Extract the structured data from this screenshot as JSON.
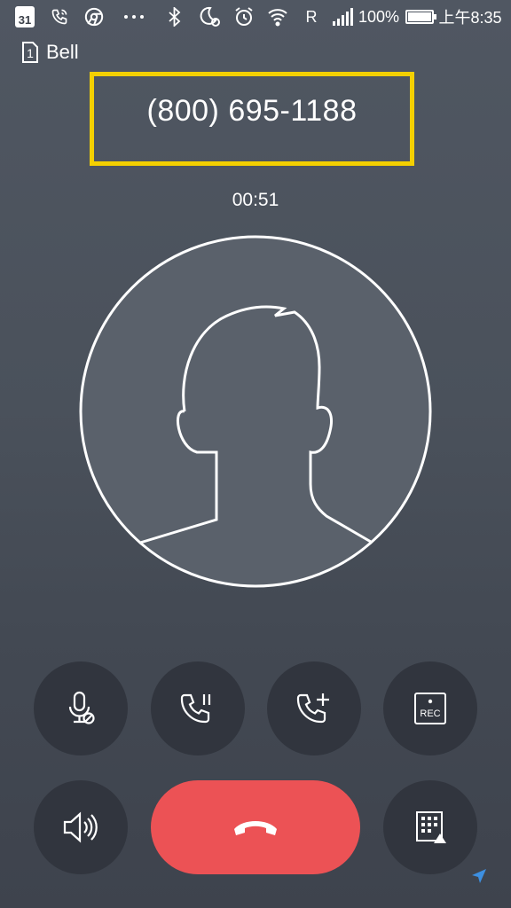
{
  "status_bar": {
    "calendar_day": "31",
    "carrier_indicator": "R",
    "battery_percent": "100%",
    "battery_level": 1.0,
    "time": "上午8:35",
    "icons": [
      "calendar-icon",
      "phone-call-icon",
      "chrome-icon",
      "more-icon",
      "bluetooth-icon",
      "do-not-disturb-moon-icon",
      "alarm-icon",
      "wifi-icon",
      "signal-icon",
      "battery-icon"
    ]
  },
  "call": {
    "sim_slot": "1",
    "carrier": "Bell",
    "phone_number": "(800) 695-1188",
    "duration": "00:51",
    "highlight_color": "#f4d000"
  },
  "actions": [
    {
      "name": "mute-button",
      "icon": "mic-mute-icon"
    },
    {
      "name": "hold-button",
      "icon": "phone-pause-icon"
    },
    {
      "name": "add-call-button",
      "icon": "phone-add-icon"
    },
    {
      "name": "record-button",
      "icon": "record-icon",
      "label": "REC"
    },
    {
      "name": "speaker-button",
      "icon": "speaker-icon"
    },
    {
      "name": "end-call-button",
      "icon": "hang-up-icon",
      "color": "#ec5255"
    },
    {
      "name": "dialpad-button",
      "icon": "dialpad-icon"
    }
  ]
}
